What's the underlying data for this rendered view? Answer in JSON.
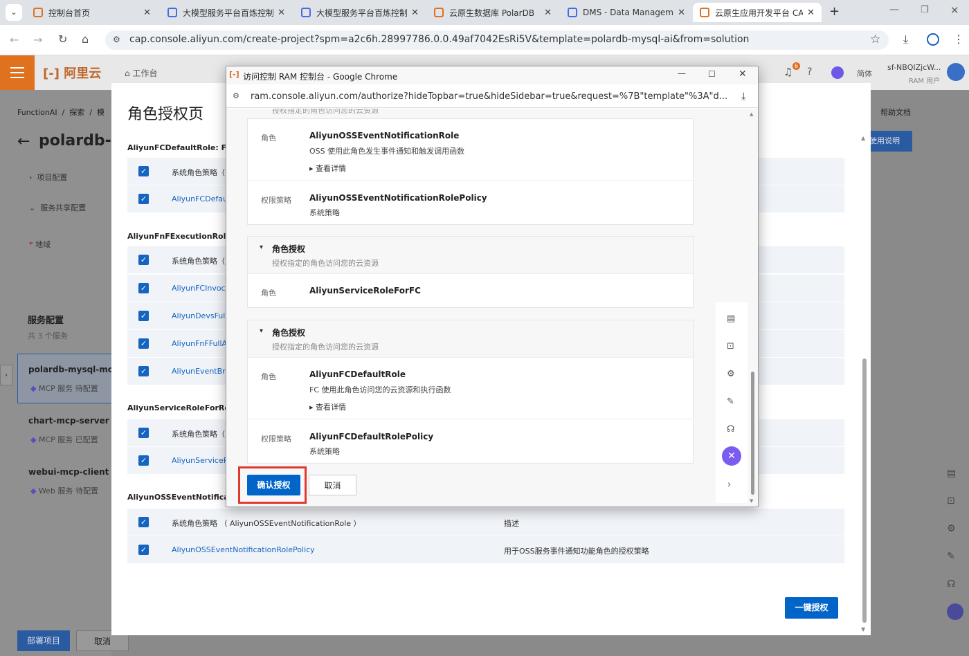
{
  "browser": {
    "tabs": [
      {
        "label": "控制台首页",
        "active": false
      },
      {
        "label": "大模型服务平台百炼控制",
        "active": false
      },
      {
        "label": "大模型服务平台百炼控制",
        "active": false
      },
      {
        "label": "云原生数据库 PolarDB",
        "active": false
      },
      {
        "label": "DMS - Data Managem",
        "active": false
      },
      {
        "label": "云原生应用开发平台 CA",
        "active": true
      }
    ],
    "url": "cap.console.aliyun.com/create-project?spm=a2c6h.28997786.0.0.49af7042EsRi5V&template=polardb-mysql-ai&from=solution"
  },
  "header": {
    "logo": "阿里云",
    "workbench": "工作台",
    "user": "sf-NBQIZjcW...",
    "user_role": "RAM 用户",
    "lang": "简体",
    "badge": "6"
  },
  "bg": {
    "breadcrumb": [
      "FunctionAI",
      "探索",
      "模"
    ],
    "project_title": "polardb-m",
    "menu": [
      "项目配置",
      "服务共享配置"
    ],
    "region_label": "地域",
    "services_title": "服务配置",
    "services_count": "共 3 个服务",
    "services": [
      {
        "name": "polardb-mysql-mcp",
        "type": "MCP 服务",
        "status": "待配置"
      },
      {
        "name": "chart-mcp-server",
        "type": "MCP 服务",
        "status": "已配置"
      },
      {
        "name": "webui-mcp-client",
        "type": "Web 服务",
        "status": "待配置"
      }
    ],
    "deploy": "部署项目",
    "cancel": "取消",
    "help_doc": "帮助文档",
    "usage": "使用说明"
  },
  "role_page": {
    "title": "角色授权页",
    "groups": [
      {
        "name": "AliyunFCDefaultRole: FC 使",
        "rows": [
          {
            "label": "系统角色策略（",
            "link": false
          },
          {
            "label": "AliyunFCDefaul",
            "link": true
          }
        ]
      },
      {
        "name": "AliyunFnFExecutionRole: 函",
        "rows": [
          {
            "label": "系统角色策略（",
            "link": false
          },
          {
            "label": "AliyunFCInvoca",
            "link": true
          },
          {
            "label": "AliyunDevsFullA",
            "link": true
          },
          {
            "label": "AliyunFnFFullAc",
            "link": true
          },
          {
            "label": "AliyunEventBrid",
            "link": true
          }
        ]
      },
      {
        "name": "AliyunServiceRoleForRdsP",
        "rows": [
          {
            "label": "系统角色策略（",
            "link": false
          },
          {
            "label": "AliyunServiceRo",
            "link": true
          }
        ]
      },
      {
        "name": "AliyunOSSEventNotificati",
        "rows": [
          {
            "label": "系统角色策略 （ AliyunOSSEventNotificationRole ）",
            "link": false,
            "desc": "描述"
          },
          {
            "label": "AliyunOSSEventNotificationRolePolicy",
            "link": true,
            "desc": "用于OSS服务事件通知功能角色的授权策略"
          }
        ]
      }
    ],
    "one_click": "一键授权"
  },
  "popup": {
    "title": "访问控制 RAM 控制台 - Google Chrome",
    "url": "ram.console.aliyun.com/authorize?hideTopbar=true&hideSidebar=true&request=%7B\"template\"%3A\"d...",
    "clipped_text": "授权指定的角色访问您的云资源",
    "role_label": "角色",
    "policy_label": "权限策略",
    "details": "查看详情",
    "system_policy": "系统策略",
    "oss_role": "AliyunOSSEventNotificationRole",
    "oss_role_desc": "OSS 使用此角色发生事件通知和触发调用函数",
    "oss_policy": "AliyunOSSEventNotificationRolePolicy",
    "section2_title": "角色授权",
    "section2_sub": "授权指定的角色访问您的云资源",
    "section2_role": "AliyunServiceRoleForFC",
    "section3_title": "角色授权",
    "section3_sub": "授权指定的角色访问您的云资源",
    "section3_role": "AliyunFCDefaultRole",
    "section3_role_desc": "FC 使用此角色访问您的云资源和执行函数",
    "section3_policy": "AliyunFCDefaultRolePolicy",
    "confirm": "确认授权",
    "cancel": "取消"
  }
}
